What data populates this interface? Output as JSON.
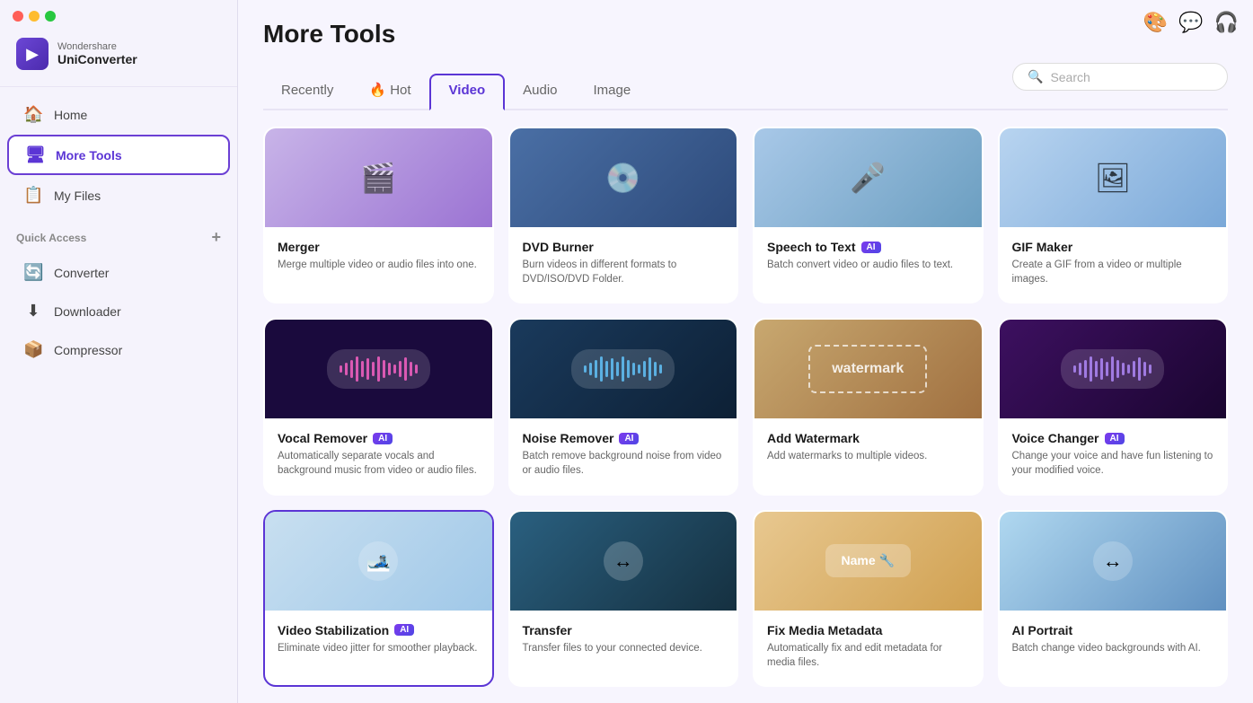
{
  "app": {
    "brand": "Wondershare",
    "name": "UniConverter",
    "icon_char": "▶"
  },
  "traffic_lights": [
    "close",
    "min",
    "max"
  ],
  "topbar": {
    "avatar_label": "👤",
    "chat_label": "💬",
    "headset_label": "🎧"
  },
  "sidebar": {
    "nav_items": [
      {
        "id": "home",
        "label": "Home",
        "icon": "🏠",
        "active": false
      },
      {
        "id": "more-tools",
        "label": "More Tools",
        "icon": "🖥",
        "active": true
      },
      {
        "id": "my-files",
        "label": "My Files",
        "icon": "📋",
        "active": false
      }
    ],
    "quick_access_label": "Quick Access",
    "quick_access_add": "+",
    "quick_access_items": [
      {
        "id": "converter",
        "label": "Converter",
        "icon": "🔄"
      },
      {
        "id": "downloader",
        "label": "Downloader",
        "icon": "⬇"
      },
      {
        "id": "compressor",
        "label": "Compressor",
        "icon": "📦"
      }
    ]
  },
  "main": {
    "page_title": "More Tools",
    "tabs": [
      {
        "id": "recently",
        "label": "Recently",
        "active": false
      },
      {
        "id": "hot",
        "label": "🔥 Hot",
        "active": false
      },
      {
        "id": "video",
        "label": "Video",
        "active": true
      },
      {
        "id": "audio",
        "label": "Audio",
        "active": false
      },
      {
        "id": "image",
        "label": "Image",
        "active": false
      }
    ],
    "search": {
      "placeholder": "Search"
    },
    "tools": [
      {
        "id": "merger",
        "name": "Merger",
        "ai": false,
        "desc": "Merge multiple video or audio files into one.",
        "thumb_class": "thumb-merger",
        "thumb_icon": "🎬",
        "selected": false
      },
      {
        "id": "dvd-burner",
        "name": "DVD Burner",
        "ai": false,
        "desc": "Burn videos in different formats to DVD/ISO/DVD Folder.",
        "thumb_class": "thumb-dvd",
        "thumb_icon": "💿",
        "selected": false
      },
      {
        "id": "speech-to-text",
        "name": "Speech to Text",
        "ai": true,
        "desc": "Batch convert video or audio files to text.",
        "thumb_class": "thumb-speech",
        "thumb_icon": "🎤",
        "selected": false
      },
      {
        "id": "gif-maker",
        "name": "GIF Maker",
        "ai": false,
        "desc": "Create a GIF from a video or multiple images.",
        "thumb_class": "thumb-gif",
        "thumb_icon": "🖼",
        "selected": false
      },
      {
        "id": "vocal-remover",
        "name": "Vocal Remover",
        "ai": true,
        "desc": "Automatically separate vocals and background music from video or audio files.",
        "thumb_class": "thumb-vocal",
        "thumb_icon": "🎵",
        "selected": false
      },
      {
        "id": "noise-remover",
        "name": "Noise Remover",
        "ai": true,
        "desc": "Batch remove background noise from video or audio files.",
        "thumb_class": "thumb-noise",
        "thumb_icon": "🔊",
        "selected": false
      },
      {
        "id": "add-watermark",
        "name": "Add Watermark",
        "ai": false,
        "desc": "Add watermarks to multiple videos.",
        "thumb_class": "thumb-watermark",
        "thumb_icon": "💧",
        "selected": false
      },
      {
        "id": "voice-changer",
        "name": "Voice Changer",
        "ai": true,
        "desc": "Change your voice and have fun listening to your modified voice.",
        "thumb_class": "thumb-voice",
        "thumb_icon": "🎙",
        "selected": false
      },
      {
        "id": "video-stabilization",
        "name": "Video Stabilization",
        "ai": true,
        "desc": "Eliminate video jitter for smoother playback.",
        "thumb_class": "thumb-vstab",
        "thumb_icon": "🎿",
        "selected": true
      },
      {
        "id": "transfer",
        "name": "Transfer",
        "ai": false,
        "desc": "Transfer files to your connected device.",
        "thumb_class": "thumb-transfer",
        "thumb_icon": "↔",
        "selected": false
      },
      {
        "id": "fix-media-metadata",
        "name": "Fix Media Metadata",
        "ai": false,
        "desc": "Automatically fix and edit metadata for media files.",
        "thumb_class": "thumb-metadata",
        "thumb_icon": "🔧",
        "selected": false
      },
      {
        "id": "ai-portrait",
        "name": "AI Portrait",
        "ai": false,
        "desc": "Batch change video backgrounds with AI.",
        "thumb_class": "thumb-portrait",
        "thumb_icon": "👤",
        "selected": false
      }
    ]
  }
}
